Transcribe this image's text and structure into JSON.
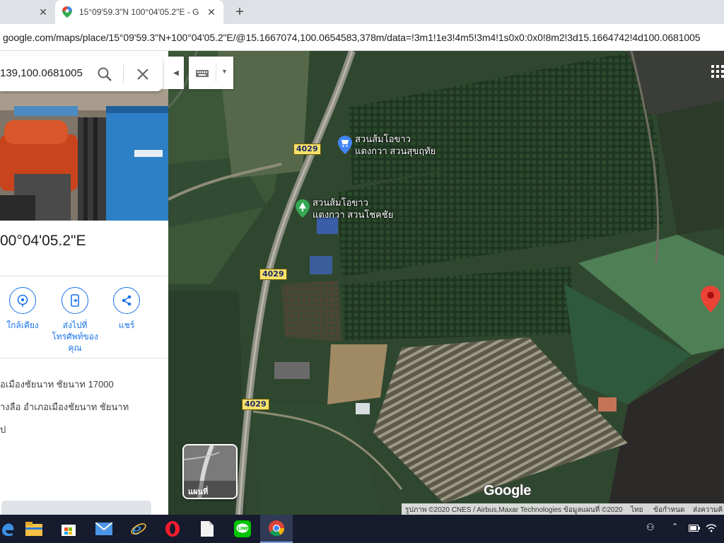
{
  "browser": {
    "tabs": [
      {
        "title": ""
      },
      {
        "title": "15°09'59.3\"N 100°04'05.2\"E - Go"
      }
    ],
    "url": "google.com/maps/place/15°09'59.3\"N+100°04'05.2\"E/@15.1667074,100.0654583,378m/data=!3m1!1e3!4m5!3m4!1s0x0:0x0!8m2!3d15.1664742!4d100.0681005"
  },
  "panel": {
    "search_value": "139,100.0681005",
    "title": "00°04'05.2\"E",
    "actions": {
      "nearby": "ใกล้เคียง",
      "send_line1": "ส่งไปที่",
      "send_line2": "โทรศัพท์ของ",
      "send_line3": "คุณ",
      "share": "แชร์"
    },
    "info": {
      "address": "อเมืองชัยนาท ชัยนาท 17000",
      "plus_code": "างลือ อำเภอเมืองชัยนาท ชัยนาท",
      "more": "ป"
    }
  },
  "map": {
    "road_shields": [
      "4029",
      "4029",
      "4029"
    ],
    "pois": [
      {
        "line1": "สวนส้มโอขาว",
        "line2": "แตงกวา สวนสุขฤทัย",
        "color": "#4285f4"
      },
      {
        "line1": "สวนส้มโอขาว",
        "line2": "แตงกวา สวนโชคชัย",
        "color": "#34a853"
      }
    ],
    "minimap_label": "แผนที่",
    "logo": "Google",
    "attribution": {
      "imagery": "รูปภาพ ©2020 CNES / Airbus,Maxar Technologies ข้อมูลแผนที่ ©2020",
      "terms_th": "ไทย",
      "terms": "ข้อกำหนด",
      "feedback": "ส่งความคิ"
    },
    "pin_color": "#ea4335"
  },
  "taskbar": {
    "items": [
      "edge-icon",
      "file-explorer-icon",
      "store-icon",
      "mail-icon",
      "internet-explorer-icon",
      "opera-icon",
      "document-icon",
      "line-icon",
      "chrome-icon"
    ]
  }
}
